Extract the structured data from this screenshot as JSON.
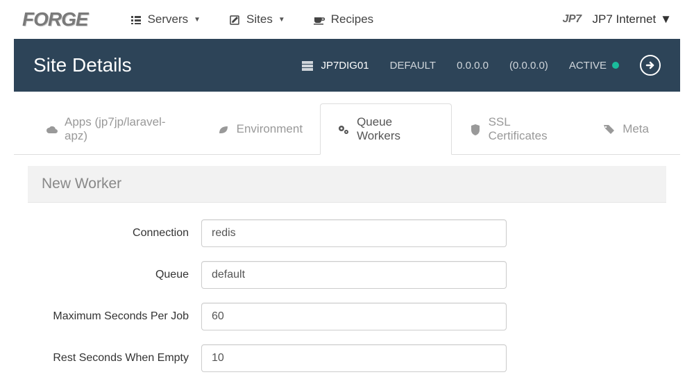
{
  "nav": {
    "logo": "FORGE",
    "items": [
      {
        "label": "Servers",
        "hasCaret": true
      },
      {
        "label": "Sites",
        "hasCaret": true
      },
      {
        "label": "Recipes",
        "hasCaret": false
      }
    ],
    "brand": "JP7",
    "user": "JP7 Internet"
  },
  "header": {
    "title": "Site Details",
    "server": "JP7DIG01",
    "env": "DEFAULT",
    "ip": "0.0.0.0",
    "ip_paren": "(0.0.0.0)",
    "status": "ACTIVE"
  },
  "tabs": [
    {
      "label": "Apps (jp7jp/laravel-apz)"
    },
    {
      "label": "Environment"
    },
    {
      "label": "Queue Workers"
    },
    {
      "label": "SSL Certificates"
    },
    {
      "label": "Meta"
    }
  ],
  "panel": {
    "heading": "New Worker"
  },
  "form": {
    "connection": {
      "label": "Connection",
      "value": "redis"
    },
    "queue": {
      "label": "Queue",
      "value": "default"
    },
    "max_seconds": {
      "label": "Maximum Seconds Per Job",
      "value": "60"
    },
    "rest_seconds": {
      "label": "Rest Seconds When Empty",
      "value": "10"
    }
  }
}
